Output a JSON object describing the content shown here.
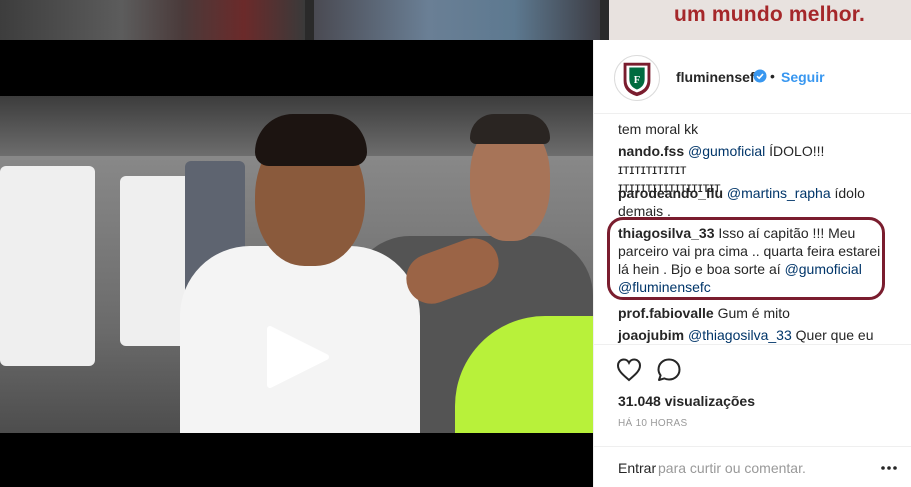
{
  "background": {
    "thumb_text": "um mundo melhor."
  },
  "video": {
    "play_icon": "play-icon"
  },
  "post": {
    "username": "fluminensefc",
    "separator": "•",
    "follow_label": "Seguir",
    "verified_icon": "verified-badge-icon"
  },
  "comments": [
    {
      "user": "",
      "text": "tem moral kk"
    },
    {
      "user": "nando.fss",
      "mention": "@gumoficial",
      "text_line1": " ÍDOLO!!! ɪᴛɪᴛɪᴛɪᴛɪᴛɪᴛ",
      "text_line2": "ɪᴛɪᴛɪᴛɪᴛɪᴛɪᴛɪᴛɪᴛɪᴛ"
    },
    {
      "user": "parodeando_flu",
      "mention": "@martins_rapha",
      "text_line1": " ídolo",
      "text_line2": "demais ."
    },
    {
      "user": "thiagosilva_33",
      "text_line1": " Isso aí capitão !!! Meu",
      "text_line2": "parceiro vai pra cima .. quarta feira estarei",
      "text_line3": "lá hein . Bjo e boa sorte aí ",
      "mention1": "@gumoficial",
      "mention2": "@fluminensefc"
    },
    {
      "user": "prof.fabiovalle",
      "text": " Gum é mito"
    },
    {
      "user": "joaojubim",
      "mention": "@thiagosilva_33",
      "text": " Quer que eu"
    }
  ],
  "actions": {
    "like_icon": "heart-icon",
    "comment_icon": "comment-icon",
    "views": "31.048 visualizações",
    "time": "HÁ 10 HORAS"
  },
  "footer": {
    "login_label": "Entrar",
    "login_rest": "para curtir ou comentar.",
    "more_icon": "more-options-icon"
  },
  "colors": {
    "link": "#3897f0",
    "mention": "#003569",
    "highlight": "#7a1d2e",
    "neon": "#b8f13a"
  }
}
